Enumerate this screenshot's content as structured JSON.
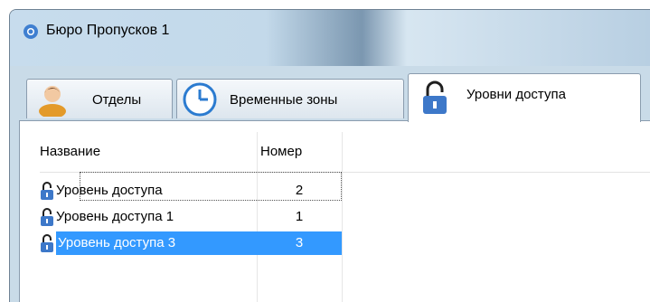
{
  "window": {
    "title": "Бюро Пропусков 1"
  },
  "tabs": [
    {
      "label": "Отделы",
      "icon": "person-icon"
    },
    {
      "label": "Временные зоны",
      "icon": "clock-icon"
    },
    {
      "label": "Уровни доступа",
      "icon": "padlock-icon"
    }
  ],
  "table": {
    "columns": [
      "Название",
      "Номер"
    ],
    "rows": [
      {
        "name": "Уровень доступа",
        "number": "2"
      },
      {
        "name": "Уровень доступа 1",
        "number": "1"
      },
      {
        "name": "Уровень доступа 3",
        "number": "3"
      }
    ]
  },
  "colors": {
    "selection": "#3399ff",
    "lock": "#3d78c9",
    "window_frame": "#c9dbe8"
  }
}
